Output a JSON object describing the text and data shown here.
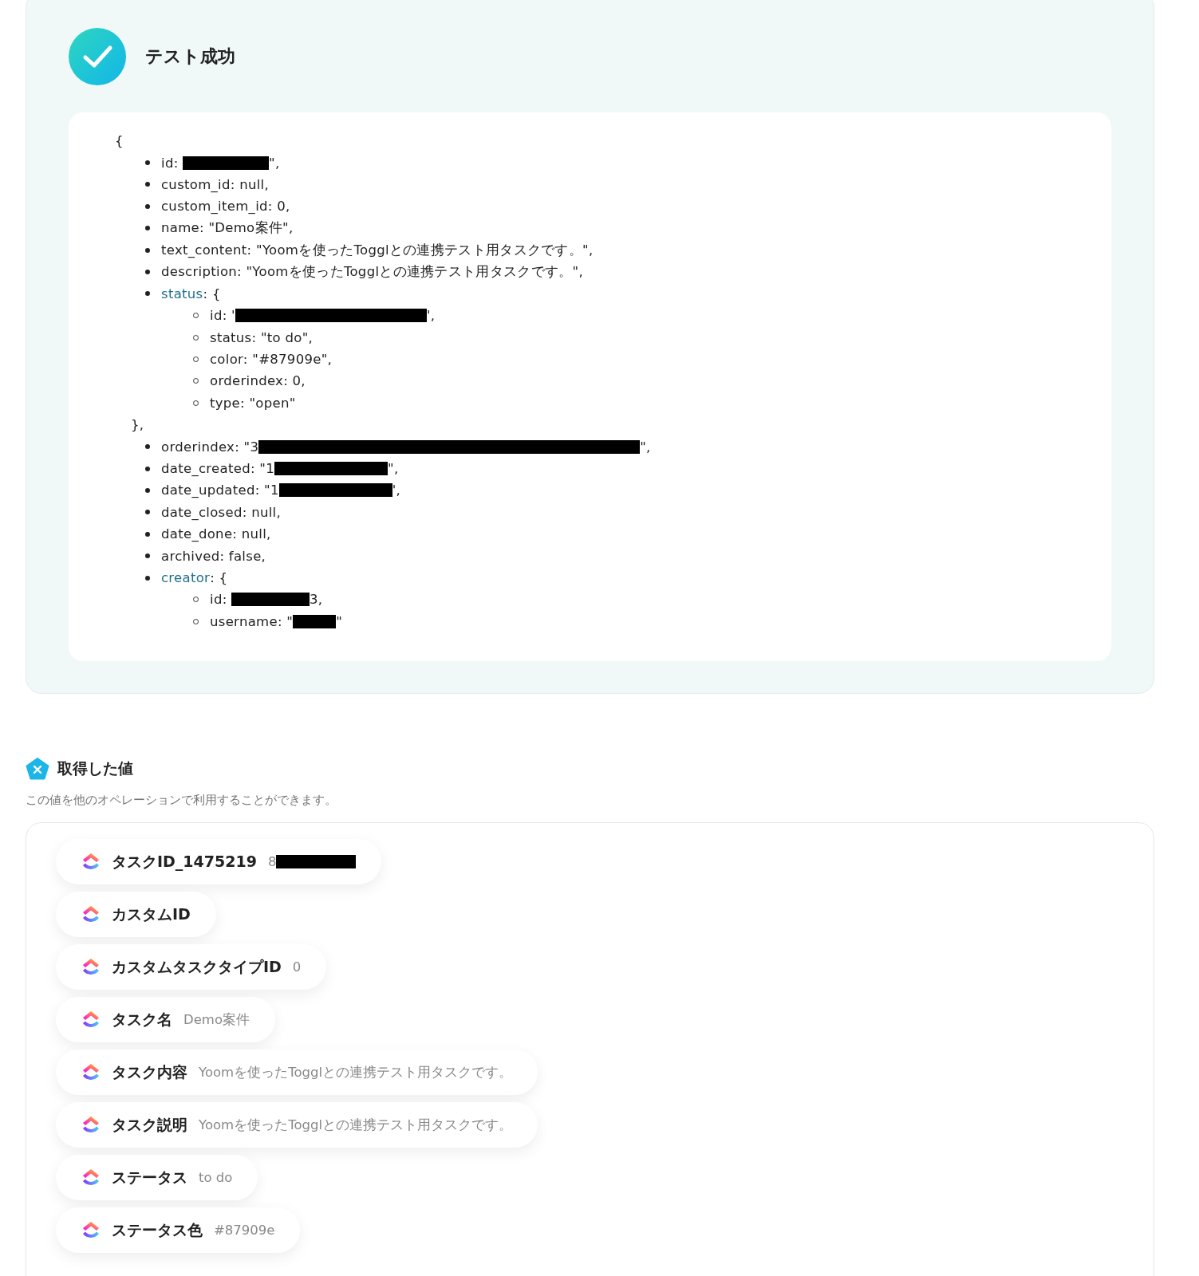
{
  "result": {
    "title": "テスト成功",
    "open_brace": "{",
    "entries": [
      {
        "text": "id: ",
        "redacted": true,
        "after": "\","
      },
      {
        "text": "custom_id: null,"
      },
      {
        "text": "custom_item_id: 0,"
      },
      {
        "text": "name: \"Demo案件\","
      },
      {
        "text": "text_content: \"Yoomを使ったTogglとの連携テスト用タスクです。\","
      },
      {
        "text": "description: \"Yoomを使ったTogglとの連携テスト用タスクです。\","
      },
      {
        "key": "status",
        "text": ": {",
        "close": "},",
        "children": [
          {
            "text": "id: '",
            "redacted": true,
            "after": "',"
          },
          {
            "text": "status: \"to do\","
          },
          {
            "text": "color: \"#87909e\","
          },
          {
            "text": "orderindex: 0,"
          },
          {
            "text": "type: \"open\""
          }
        ]
      },
      {
        "text": "orderindex: \"3",
        "redacted": true,
        "after": "\","
      },
      {
        "text": "date_created: \"1",
        "redacted": true,
        "after": "\","
      },
      {
        "text": "date_updated: \"1",
        "redacted": true,
        "after": "',"
      },
      {
        "text": "date_closed: null,"
      },
      {
        "text": "date_done: null,"
      },
      {
        "text": "archived: false,"
      },
      {
        "key": "creator",
        "text": ": {",
        "children": [
          {
            "text": "id: ",
            "redacted": true,
            "after": "3,"
          },
          {
            "text": "username: \"",
            "redacted": true,
            "after": "\""
          }
        ]
      }
    ]
  },
  "values": {
    "title": "取得した値",
    "description": "この値を他のオペレーションで利用することができます。",
    "items": [
      {
        "label": "タスクID_1475219",
        "value": "8",
        "redacted": true
      },
      {
        "label": "カスタムID"
      },
      {
        "label": "カスタムタスクタイプID",
        "value": "0"
      },
      {
        "label": "タスク名",
        "value": "Demo案件"
      },
      {
        "label": "タスク内容",
        "value": "Yoomを使ったTogglとの連携テスト用タスクです。"
      },
      {
        "label": "タスク説明",
        "value": "Yoomを使ったTogglとの連携テスト用タスクです。"
      },
      {
        "label": "ステータス",
        "value": "to do"
      },
      {
        "label": "ステータス色",
        "value": "#87909e"
      }
    ]
  }
}
